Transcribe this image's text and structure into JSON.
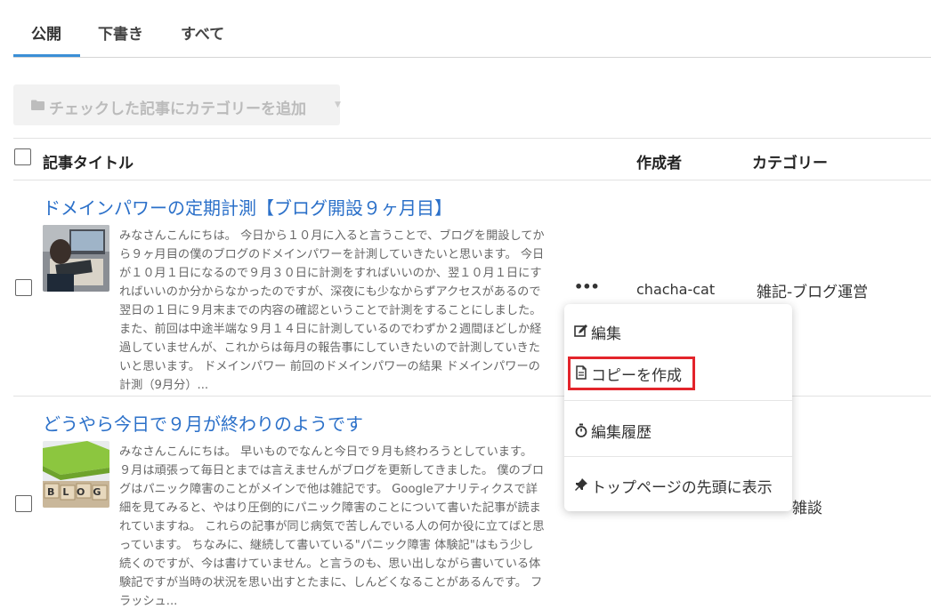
{
  "tabs": [
    {
      "label": "公開"
    },
    {
      "label": "下書き"
    },
    {
      "label": "すべて"
    }
  ],
  "bulk_category_button": {
    "label": "チェックした記事にカテゴリーを追加"
  },
  "table_header": {
    "title": "記事タイトル",
    "author": "作成者",
    "category": "カテゴリー"
  },
  "posts": [
    {
      "title": "ドメインパワーの定期計測【ブログ開設９ヶ月目】",
      "excerpt": "みなさんこんにちは。 今日から１０月に入ると言うことで、ブログを開設してから９ヶ月目の僕のブログのドメインパワーを計測していきたいと思います。 今日が１０月１日になるので９月３０日に計測をすればいいのか、翌１０月１日にすればいいのか分からなかったのですが、深夜にも少なからずアクセスがあるので翌日の１日に９月末までの内容の確認ということで計測をすることにしました。 また、前回は中途半端な９月１４日に計測しているのでわずか２週間ほどしか経過していませんが、これからは毎月の報告事にしていきたいので計測していきたいと思います。 ドメインパワー 前回のドメインパワーの結果 ドメインパワーの計測（9月分）...",
      "author": "chacha-cat",
      "category": "雑記-ブログ運営"
    },
    {
      "title": "どうやら今日で９月が終わりのようです",
      "excerpt": "みなさんこんにちは。 早いものでなんと今日で９月も終わろうとしています。 ９月は頑張って毎日とまでは言えませんがブログを更新してきました。 僕のブログはパニック障害のことがメインで他は雑記です。 Googleアナリティクスで詳細を見てみると、やはり圧倒的にパニック障害のことについて書いた記事が読まれていますね。 これらの記事が同じ病気で苦しんでいる人の何か役に立てばと思っています。 ちなみに、継続して書いている\"パニック障害 体験記\"はもう少し続くのですが、今は書けていません。と言うのも、思い出しながら書いている体験記ですが当時の状況を思い出すとたまに、しんどくなることがあるんです。 フラッシュ...",
      "thumb_text": "BLOG",
      "category": "雑談"
    }
  ],
  "more_button": {
    "label": "•••"
  },
  "context_menu": {
    "items": [
      {
        "label": "編集",
        "icon": "edit-icon"
      },
      {
        "label": "コピーを作成",
        "icon": "document-icon"
      },
      {
        "label": "編集履歴",
        "icon": "stopwatch-icon"
      },
      {
        "label": "トップページの先頭に表示",
        "icon": "pin-icon"
      }
    ]
  },
  "colors": {
    "accent": "#3b8fd6",
    "link": "#2b70c9",
    "highlight": "#e3242b"
  }
}
